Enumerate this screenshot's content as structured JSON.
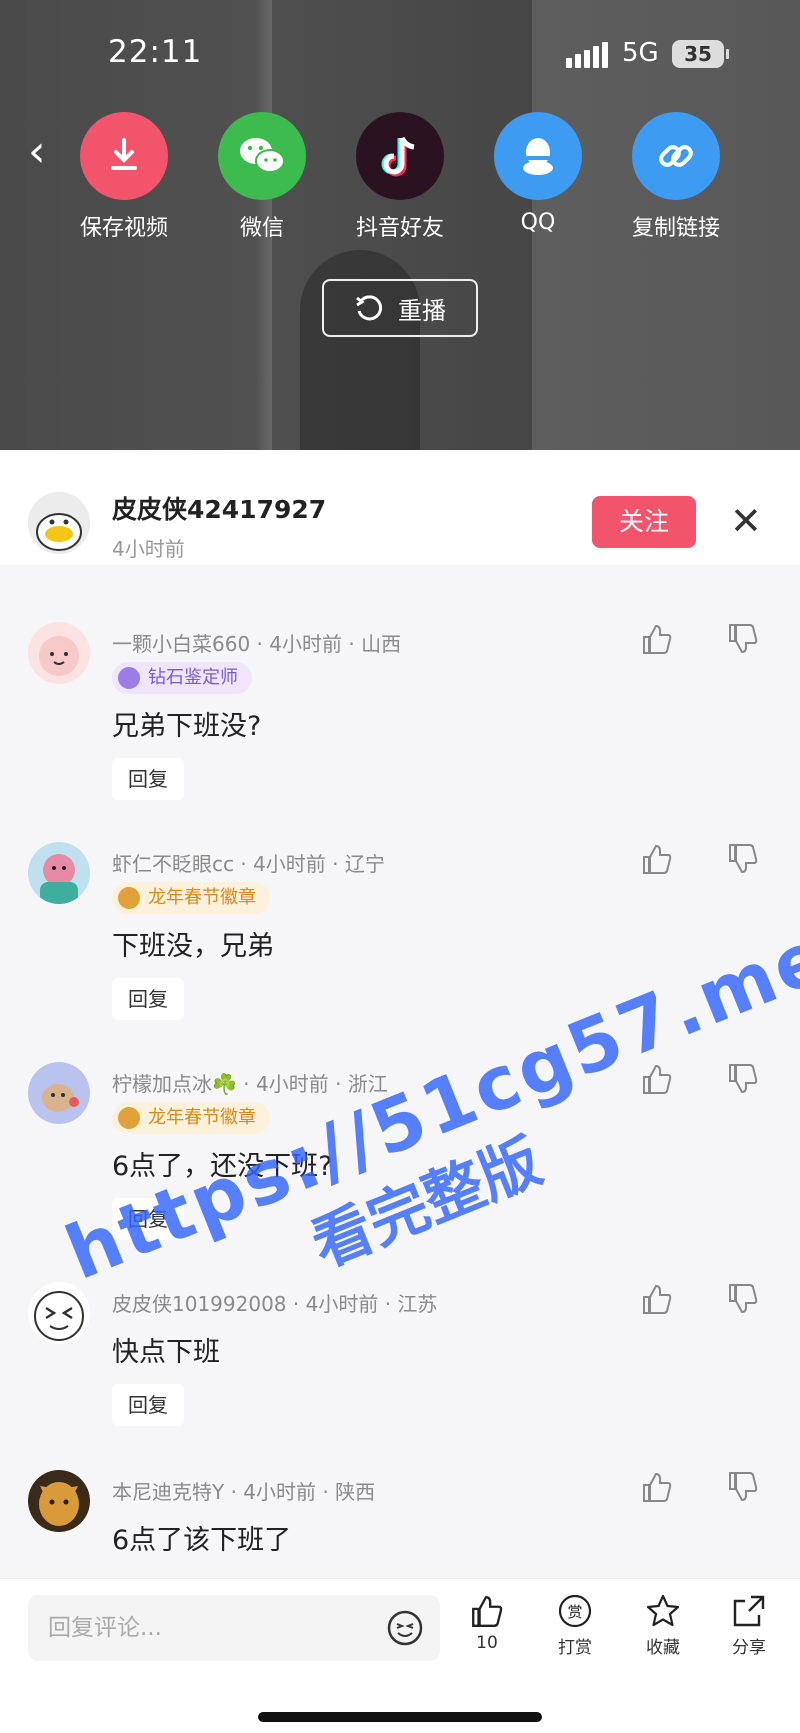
{
  "status": {
    "time": "22:11",
    "network": "5G",
    "battery": "35"
  },
  "share": {
    "items": [
      {
        "label": "保存视频",
        "icon": "download-icon",
        "color": "#f2556b"
      },
      {
        "label": "微信",
        "icon": "wechat-icon",
        "color": "#3dbb4e"
      },
      {
        "label": "抖音好友",
        "icon": "tiktok-icon",
        "color": "#2b1220"
      },
      {
        "label": "QQ",
        "icon": "qq-icon",
        "color": "#3d9bf2"
      },
      {
        "label": "复制链接",
        "icon": "link-icon",
        "color": "#3d9bf2"
      }
    ],
    "replay_label": "重播"
  },
  "author": {
    "name": "皮皮侠42417927",
    "time": "4小时前",
    "follow_label": "关注"
  },
  "comments": [
    {
      "user": "一颗小白菜660",
      "time": "4小时前",
      "region": "山西",
      "badge": "钻石鉴定师",
      "badge_color": "#7a5bd6",
      "text": "兄弟下班没?",
      "reply": "回复"
    },
    {
      "user": "虾仁不眨眼cc",
      "time": "4小时前",
      "region": "辽宁",
      "badge": "龙年春节徽章",
      "badge_color": "#d98a1a",
      "text": "下班没，兄弟",
      "reply": "回复"
    },
    {
      "user": "柠檬加点冰☘️",
      "time": "4小时前",
      "region": "浙江",
      "badge": "龙年春节徽章",
      "badge_color": "#d98a1a",
      "text": "6点了，还没下班?",
      "reply": "回复"
    },
    {
      "user": "皮皮侠101992008",
      "time": "4小时前",
      "region": "江苏",
      "text": "快点下班",
      "reply": "回复"
    },
    {
      "user": "本尼迪克特Y",
      "time": "4小时前",
      "region": "陕西",
      "text": "6点了该下班了"
    }
  ],
  "watermark": {
    "line1": "https://51cg57.me",
    "line2": "看完整版"
  },
  "bottom": {
    "placeholder": "回复评论...",
    "like_count": "10",
    "reward_label": "打赏",
    "favorite_label": "收藏",
    "share_label": "分享"
  },
  "colors": {
    "accent": "#f2556b",
    "watermark": "#3264ff"
  }
}
